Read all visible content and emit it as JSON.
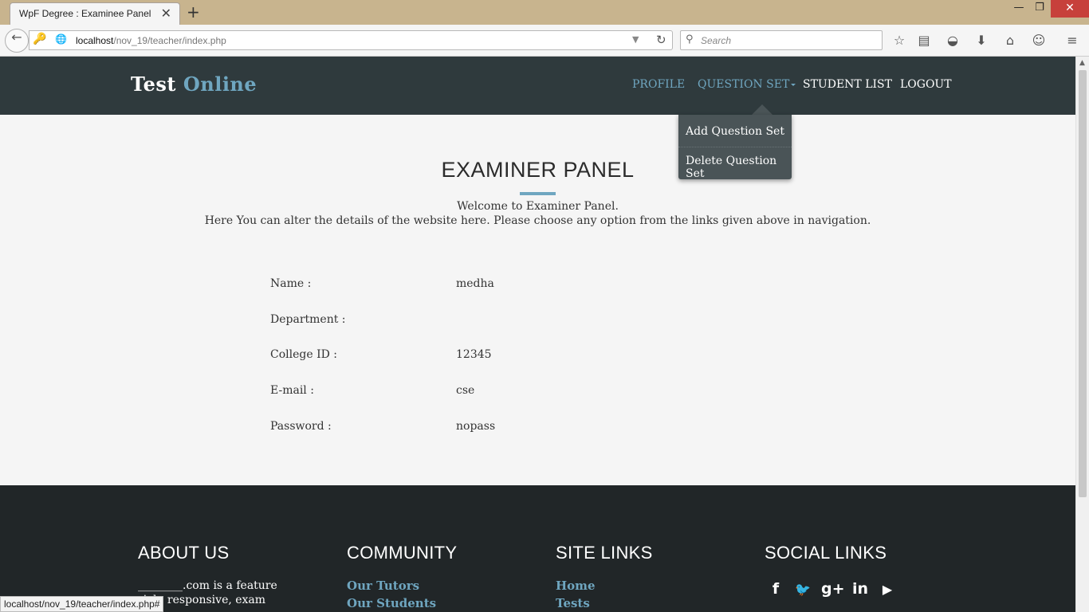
{
  "browser": {
    "tab_title": "WpF Degree : Examinee Panel",
    "tab_close": "✕",
    "new_tab": "+",
    "window_controls": {
      "minimize": "—",
      "restore": "❐",
      "close": "✕"
    },
    "url_host": "localhost",
    "url_path": "/nov_19/teacher/index.php",
    "search_placeholder": "Search",
    "toolbar_icons": [
      "bookmark-star-icon",
      "reading-list-icon",
      "pocket-icon",
      "download-icon",
      "home-icon",
      "smiley-icon",
      "menu-icon"
    ],
    "status_url": "localhost/nov_19/teacher/index.php#"
  },
  "site": {
    "brand_word1": "Test",
    "brand_word2": "Online",
    "nav": {
      "profile": "PROFILE",
      "question_set": "QUESTION SET",
      "student_list": "STUDENT LIST",
      "logout": "LOGOUT"
    },
    "dropdown": {
      "add": "Add Question Set",
      "delete": "Delete Question Set"
    }
  },
  "main": {
    "title": "EXAMINER PANEL",
    "welcome_line1": "Welcome to Examiner Panel.",
    "welcome_line2": "Here You can alter the details of the website here. Please choose any option from the links given above in navigation.",
    "info": [
      {
        "label": "Name :",
        "value": "medha"
      },
      {
        "label": "Department :",
        "value": ""
      },
      {
        "label": "College ID :",
        "value": "12345"
      },
      {
        "label": "E-mail :",
        "value": "cse"
      },
      {
        "label": "Password :",
        "value": "nopass"
      }
    ]
  },
  "footer": {
    "about_title": "ABOUT US",
    "about_text": "________.com is a feature rich, responsive, exam",
    "community_title": "COMMUNITY",
    "community_links": [
      "Our Tutors",
      "Our Students"
    ],
    "site_links_title": "SITE LINKS",
    "site_links": [
      "Home",
      "Tests"
    ],
    "social_title": "SOCIAL LINKS",
    "social_icons": [
      {
        "name": "facebook-icon",
        "glyph": "f"
      },
      {
        "name": "twitter-icon",
        "glyph": "🐦"
      },
      {
        "name": "google-plus-icon",
        "glyph": "g+"
      },
      {
        "name": "linkedin-icon",
        "glyph": "in"
      },
      {
        "name": "youtube-icon",
        "glyph": "▶"
      }
    ]
  },
  "colors": {
    "accent": "#6fa6c0",
    "header_bg": "#2f3a3d",
    "footer_bg": "#212628",
    "dropdown_bg": "#4a5457"
  }
}
